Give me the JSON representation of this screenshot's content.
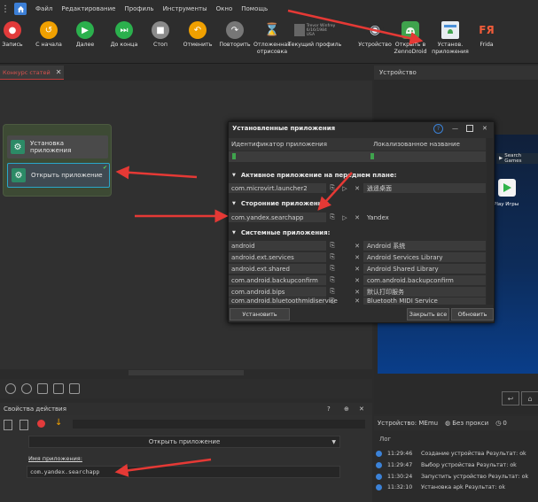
{
  "menu": {
    "items": [
      "Файл",
      "Редактирование",
      "Профиль",
      "Инструменты",
      "Окно",
      "Помощь"
    ]
  },
  "toolbar": {
    "buttons": [
      {
        "label": "Запись",
        "color": "#e23b3b",
        "glyph": "●"
      },
      {
        "label": "С начала",
        "color": "#f0a000",
        "glyph": "↺"
      },
      {
        "label": "Далее",
        "color": "#2bb04d",
        "glyph": "▶"
      },
      {
        "label": "До конца",
        "color": "#2bb04d",
        "glyph": "⏭"
      },
      {
        "label": "Стоп",
        "color": "#8a8a8a",
        "glyph": "■"
      },
      {
        "label": "Отменить",
        "color": "#f0a000",
        "glyph": "↶"
      },
      {
        "label": "Повторить",
        "color": "#777777",
        "glyph": "↷"
      },
      {
        "label": "Отложенная\nотрисовка",
        "color": "#2d2d2d",
        "glyph": "⌛"
      },
      {
        "label": "Текущий профиль",
        "color": "#555555",
        "glyph": ""
      },
      {
        "label": "Устройство",
        "color": "#2d2d2d",
        "glyph": "◉"
      },
      {
        "label": "Открыть в\nZennoDroid",
        "color": "#2d2d2d",
        "glyph": ""
      },
      {
        "label": "Установ.\nприложения",
        "color": "#2d2d2d",
        "glyph": ""
      },
      {
        "label": "Frida",
        "color": "#2d2d2d",
        "glyph": "FЯ"
      }
    ],
    "profile_lines": [
      "Trevor Winfrey",
      "6/16/1984",
      "USA"
    ]
  },
  "tab": {
    "label": "Конкурс статей"
  },
  "nodes": {
    "install": "Установка\nприложения",
    "open": "Открыть приложение"
  },
  "props": {
    "title": "Свойства действия",
    "help": "?",
    "action": "Открыть приложение",
    "app_name_label": "Имя приложения:",
    "app_name_value": "com.yandex.searchapp"
  },
  "device": {
    "header": "Устройство",
    "status": "Устройство: MEmu",
    "proxy": "Без прокси",
    "counter": "0",
    "search_games": "Search Games",
    "play_label": "Play Игры"
  },
  "log": {
    "title": "Лог",
    "rows": [
      {
        "time": "11:29:46",
        "text": "Создание устройства  Результат: ok"
      },
      {
        "time": "11:29:47",
        "text": "Выбор устройства  Результат: ok"
      },
      {
        "time": "11:30:24",
        "text": "Запустить устройство  Результат: ok"
      },
      {
        "time": "11:32:10",
        "text": "Установка apk  Результат: ok"
      }
    ]
  },
  "dialog": {
    "title": "Установленные приложения",
    "col_id": "Идентификатор приложения",
    "col_name": "Локализованное название",
    "section_active": "Активное приложение на переднем плане:",
    "section_third": "Сторонние приложения:",
    "section_system": "Системные приложения:",
    "active": [
      {
        "id": "com.microvirt.launcher2",
        "name": "逍遥桌面"
      }
    ],
    "third": [
      {
        "id": "com.yandex.searchapp",
        "name": "Yandex"
      }
    ],
    "system": [
      {
        "id": "android",
        "name": "Android 系统"
      },
      {
        "id": "android.ext.services",
        "name": "Android Services Library"
      },
      {
        "id": "android.ext.shared",
        "name": "Android Shared Library"
      },
      {
        "id": "com.android.backupconfirm",
        "name": "com.android.backupconfirm"
      },
      {
        "id": "com.android.bips",
        "name": "默认打印服务"
      },
      {
        "id": "com.android.bluetoothmidiservice",
        "name": "Bluetooth MIDI Service"
      }
    ],
    "btn_install": "Установить",
    "btn_close_all": "Закрыть все",
    "btn_refresh": "Обновить"
  }
}
